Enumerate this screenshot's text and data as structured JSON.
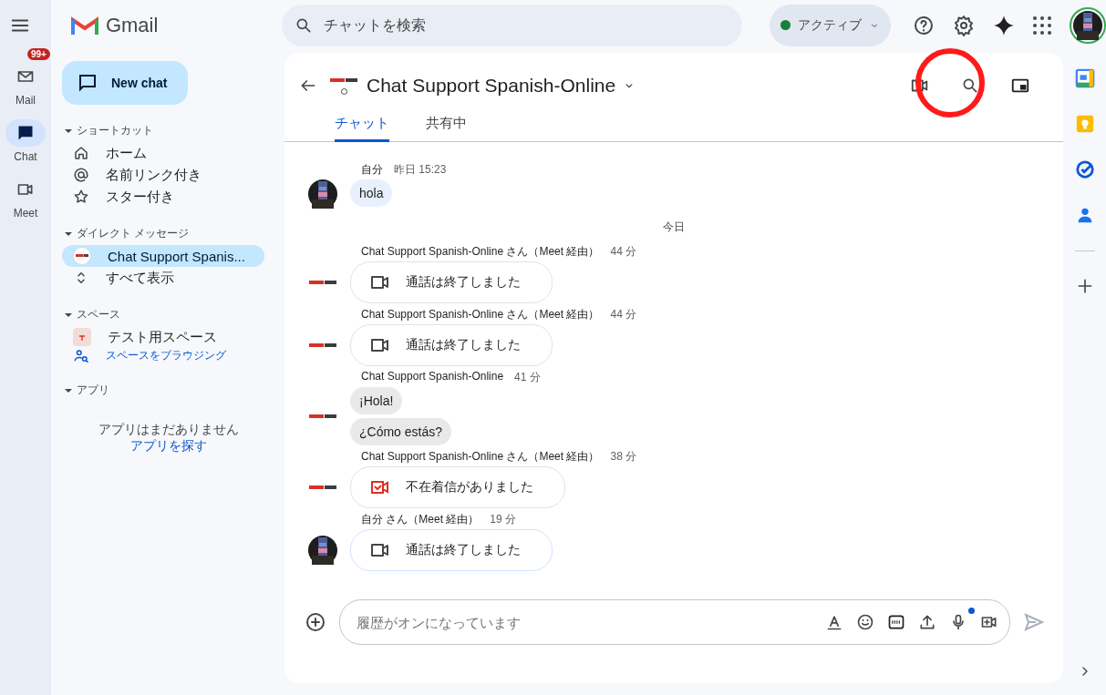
{
  "app": {
    "name": "Gmail"
  },
  "search": {
    "placeholder": "チャットを検索"
  },
  "status": {
    "label": "アクティブ",
    "color": "#188038"
  },
  "rail": [
    {
      "label": "Mail",
      "badge": "99+",
      "kind": "mail",
      "selected": false
    },
    {
      "label": "Chat",
      "kind": "chat",
      "selected": true
    },
    {
      "label": "Meet",
      "kind": "meet",
      "selected": false
    }
  ],
  "new_chat": "New chat",
  "sections": [
    {
      "title": "ショートカット",
      "expanded": true,
      "items": [
        {
          "label": "ホーム",
          "kind": "home",
          "selected": false
        },
        {
          "label": "名前リンク付き",
          "kind": "mention",
          "selected": false
        },
        {
          "label": "スター付き",
          "kind": "star",
          "selected": false
        }
      ]
    },
    {
      "title": "ダイレクト メッセージ",
      "expanded": true,
      "items": [
        {
          "label": "Chat Support Spanis...",
          "kind": "contact",
          "selected": true
        },
        {
          "label": "すべて表示",
          "kind": "more",
          "selected": false
        }
      ]
    },
    {
      "title": "スペース",
      "expanded": true,
      "items": [
        {
          "label": "テスト用スペース",
          "kind": "space",
          "selected": false
        },
        {
          "label": "スペースをブラウジング",
          "kind": "browse",
          "selected": false
        }
      ]
    },
    {
      "title": "アプリ",
      "expanded": true,
      "empty": "アプリはまだありません",
      "link": "アプリを探す"
    }
  ],
  "conversation": {
    "title": "Chat Support Spanish-Online",
    "tabs": [
      {
        "label": "チャット",
        "selected": true
      },
      {
        "label": "共有中",
        "selected": false
      }
    ],
    "messages": [
      {
        "sender": "自分",
        "time": "昨日 15:23",
        "kind": "self",
        "bubbles": [
          {
            "kind": "text",
            "text": "hola"
          }
        ]
      },
      {
        "kind": "divider",
        "divider": "今日"
      },
      {
        "sender": "Chat Support Spanish-Online さん（Meet 経由）",
        "time": "44 分",
        "kind": "org",
        "bubbles": [
          {
            "kind": "call_ended",
            "text": "通話は終了しました"
          }
        ]
      },
      {
        "sender": "Chat Support Spanish-Online さん（Meet 経由）",
        "time": "44 分",
        "kind": "org",
        "bubbles": [
          {
            "kind": "call_ended",
            "text": "通話は終了しました"
          }
        ]
      },
      {
        "sender": "Chat Support Spanish-Online",
        "time": "41 分",
        "kind": "org",
        "bubbles": [
          {
            "kind": "text",
            "text": "¡Hola!"
          },
          {
            "kind": "text",
            "text": "¿Cómo estás?"
          }
        ]
      },
      {
        "sender": "Chat Support Spanish-Online さん（Meet 経由）",
        "time": "38 分",
        "kind": "org",
        "bubbles": [
          {
            "kind": "missed_call",
            "text": "不在着信がありました"
          }
        ]
      },
      {
        "sender": "自分 さん（Meet 経由）",
        "time": "19 分",
        "kind": "self",
        "bubbles": [
          {
            "kind": "call_ended",
            "text": "通話は終了しました"
          }
        ]
      }
    ],
    "composer": {
      "placeholder": "履歴がオンになっています"
    }
  }
}
